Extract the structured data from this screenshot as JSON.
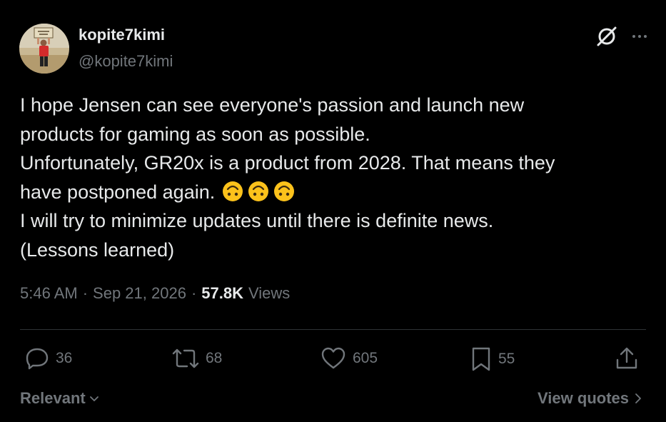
{
  "author": {
    "name": "kopite7kimi",
    "handle": "@kopite7kimi"
  },
  "post": {
    "lines": [
      "I hope Jensen can see everyone's passion and launch new",
      "products for gaming as soon as possible.",
      "Unfortunately, GR20x is a product from 2028. That means they",
      "have postponed again.",
      "I will try to minimize updates until there is definite news.",
      "(Lessons learned)"
    ],
    "emoji": [
      "upside-down-face",
      "upside-down-face",
      "upside-down-face"
    ]
  },
  "meta": {
    "time": "5:46 AM",
    "separator": "·",
    "date": "Sep 21, 2026",
    "views_count": "57.8K",
    "views_label": "Views"
  },
  "actions": {
    "replies": "36",
    "reposts": "68",
    "likes": "605",
    "bookmarks": "55"
  },
  "footer": {
    "sort_label": "Relevant",
    "view_quotes_label": "View quotes"
  },
  "icons": {
    "top": [
      "grok-icon",
      "more-icon"
    ],
    "actions": [
      "reply-icon",
      "repost-icon",
      "like-icon",
      "bookmark-icon",
      "share-icon"
    ]
  },
  "colors": {
    "background": "#000000",
    "text": "#e7e9ea",
    "muted": "#71767b",
    "divider": "#2f3336",
    "emoji": "#fcc21b"
  }
}
